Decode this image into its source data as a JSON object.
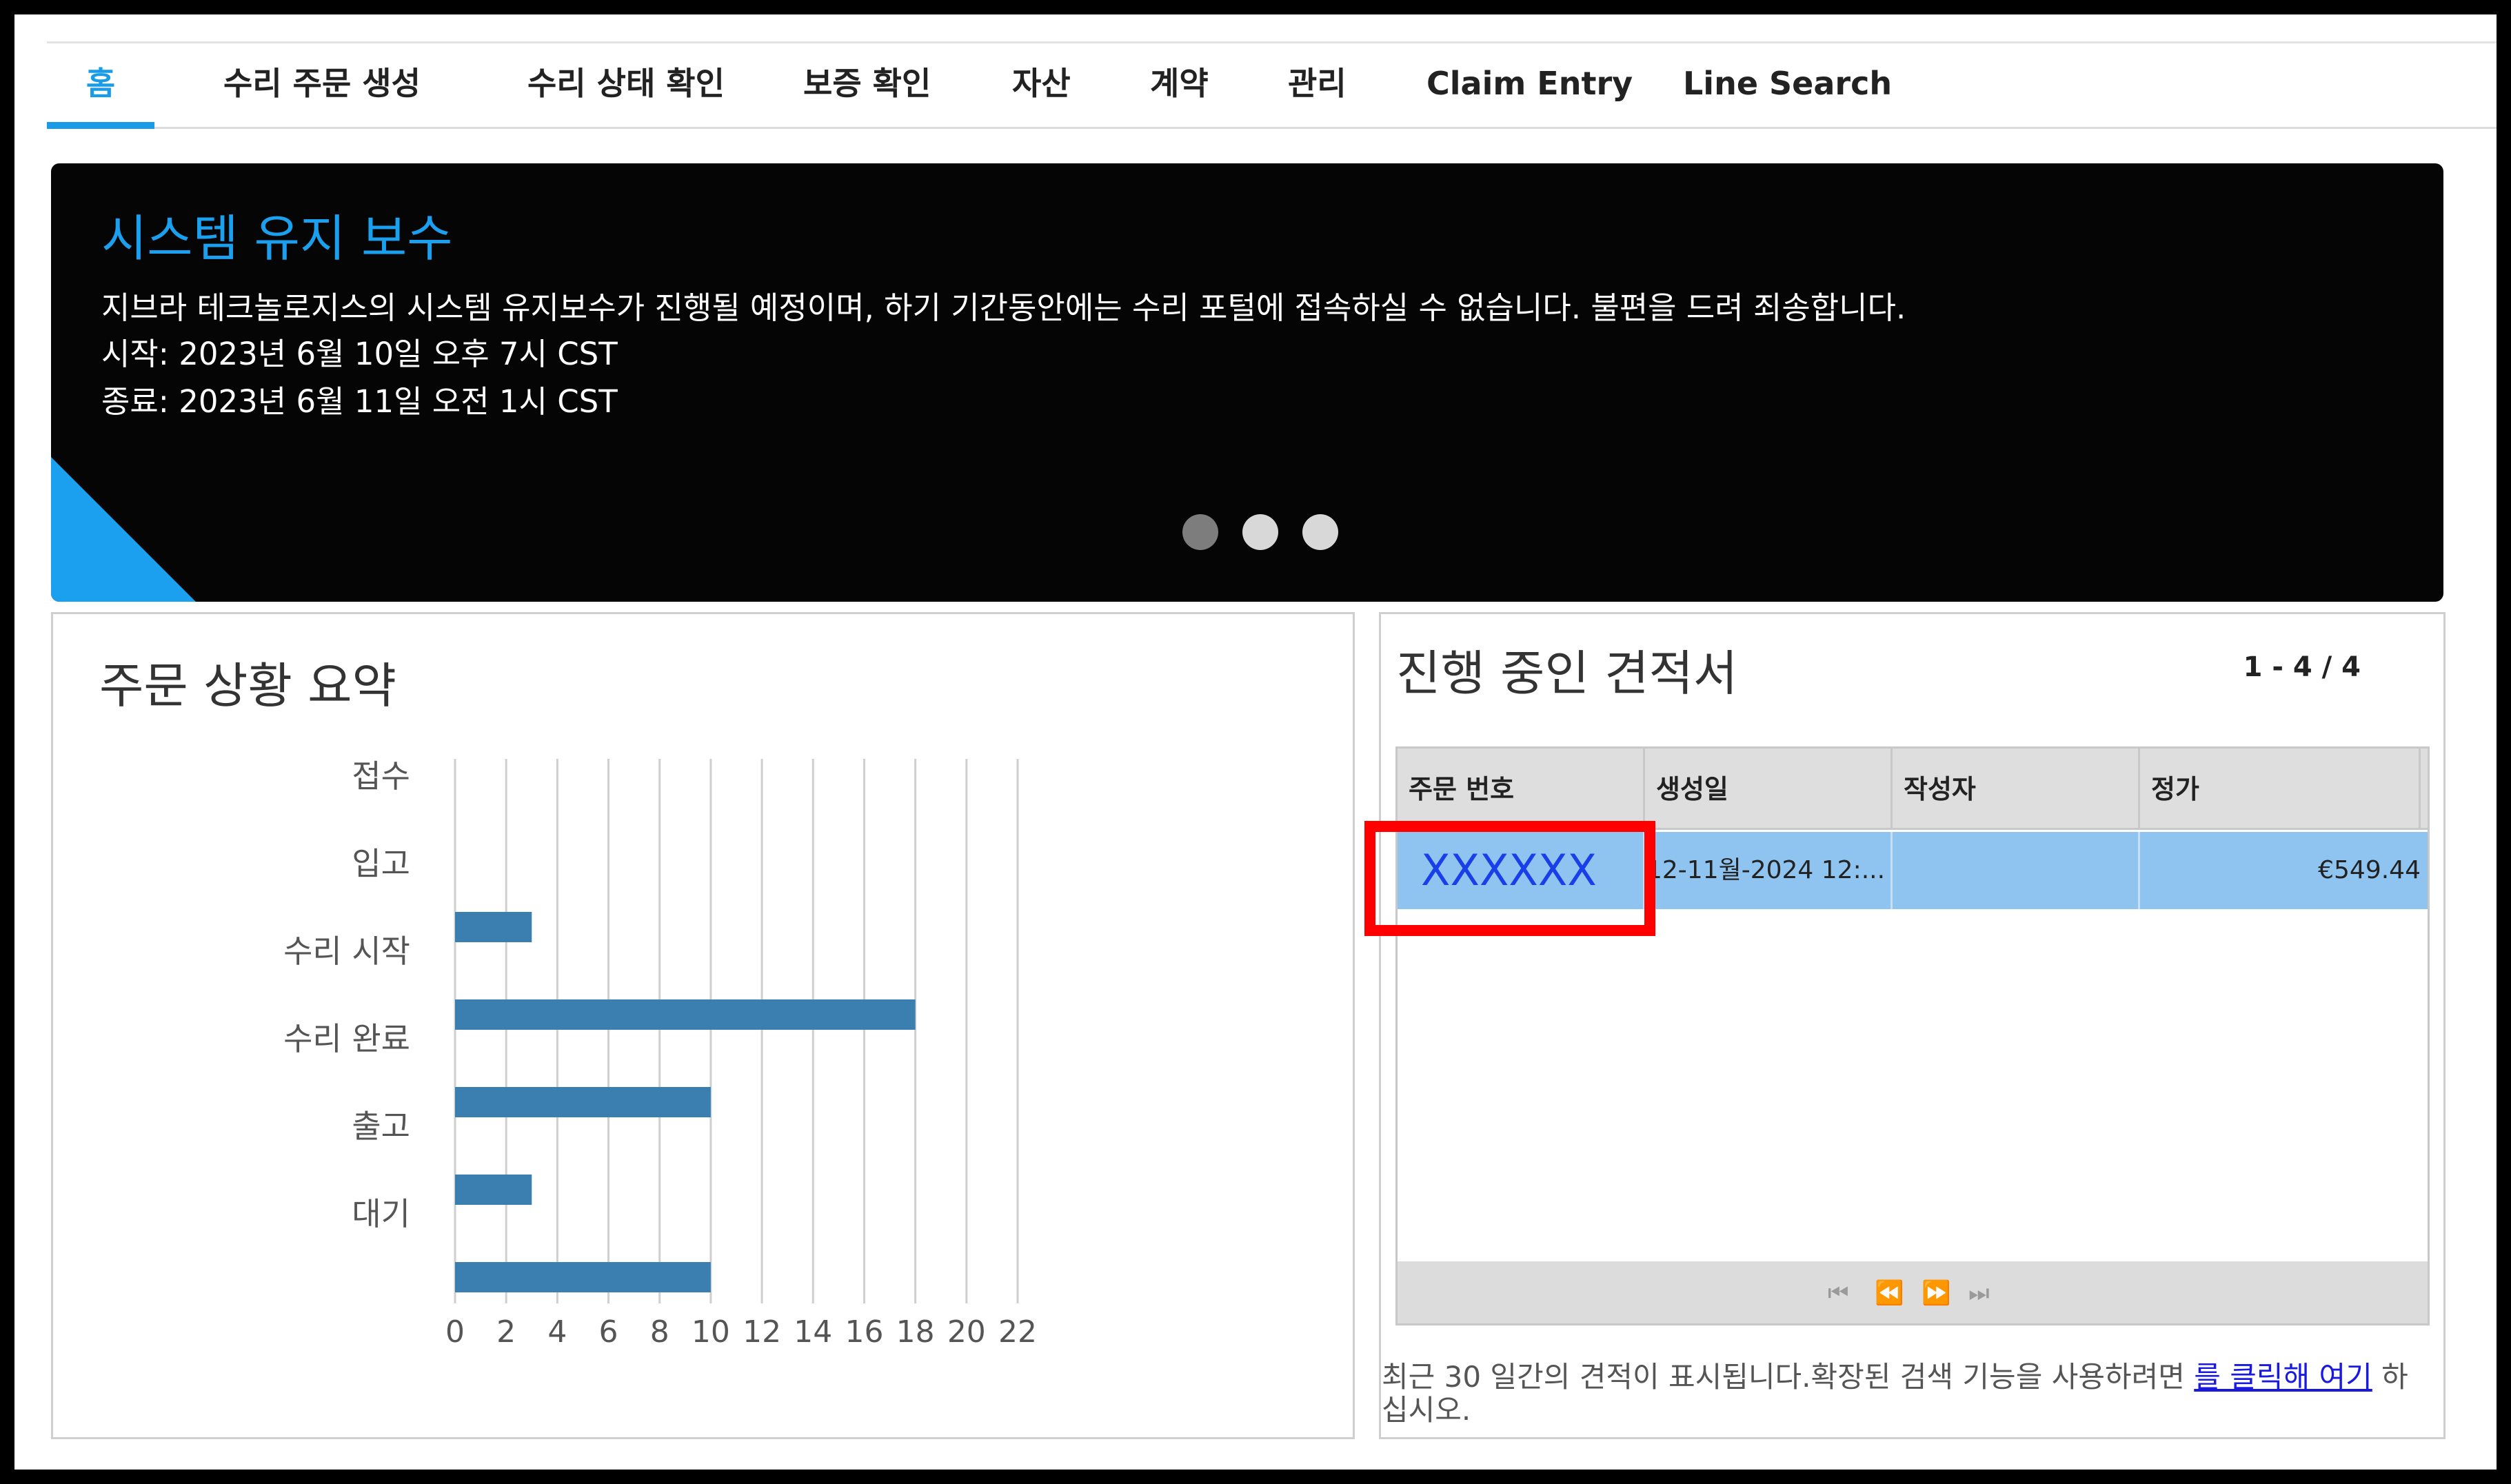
{
  "nav": {
    "tabs": [
      {
        "label": "홈",
        "active": true
      },
      {
        "label": "수리 주문 생성"
      },
      {
        "label": "수리 상태 확인"
      },
      {
        "label": "보증 확인"
      },
      {
        "label": "자산"
      },
      {
        "label": "계약"
      },
      {
        "label": "관리"
      },
      {
        "label": "Claim Entry"
      },
      {
        "label": "Line Search"
      }
    ]
  },
  "banner": {
    "title": "시스템 유지 보수",
    "message": "지브라 테크놀로지스의 시스템 유지보수가 진행될 예정이며, 하기 기간동안에는 수리 포털에 접속하실 수 없습니다. 불편을 드려 죄송합니다.",
    "start": "시작: 2023년 6월 10일 오후 7시 CST",
    "end": "종료: 2023년 6월 11일 오전 1시 CST",
    "dots": 3,
    "accent_color": "#1aa0ee"
  },
  "summary": {
    "title": "주문 상황 요약"
  },
  "chart_data": {
    "type": "bar",
    "orientation": "horizontal",
    "categories": [
      "접수",
      "입고",
      "수리 시작",
      "수리 완료",
      "출고",
      "대기"
    ],
    "values": [
      0,
      3,
      18,
      10,
      3,
      10
    ],
    "xlim": [
      0,
      22
    ],
    "xticks": [
      "0",
      "2",
      "4",
      "6",
      "8",
      "10",
      "12",
      "14",
      "16",
      "18",
      "20",
      "22"
    ],
    "grid": true,
    "bar_color": "#3a7fb0"
  },
  "quotes": {
    "title": "진행 중인 견적서",
    "count": "1 - 4 / 4",
    "columns": [
      "주문 번호",
      "생성일",
      "작성자",
      "정가"
    ],
    "rows": [
      {
        "order_no": "XXXXXX",
        "created": "12-11월-2024 12:...",
        "author": "",
        "price": "€549.44"
      }
    ],
    "pager_icons": [
      "first-page-icon",
      "previous-page-icon",
      "next-page-icon",
      "last-page-icon"
    ],
    "note_prefix": "최근 30 일간의 견적이 표시됩니다.확장된 검색 기능을 사용하려면 ",
    "note_link": "를 클릭해 여기",
    "note_suffix": " 하십시오.",
    "highlight_color": "#ff0000",
    "row_color": "#8ec4ef"
  }
}
